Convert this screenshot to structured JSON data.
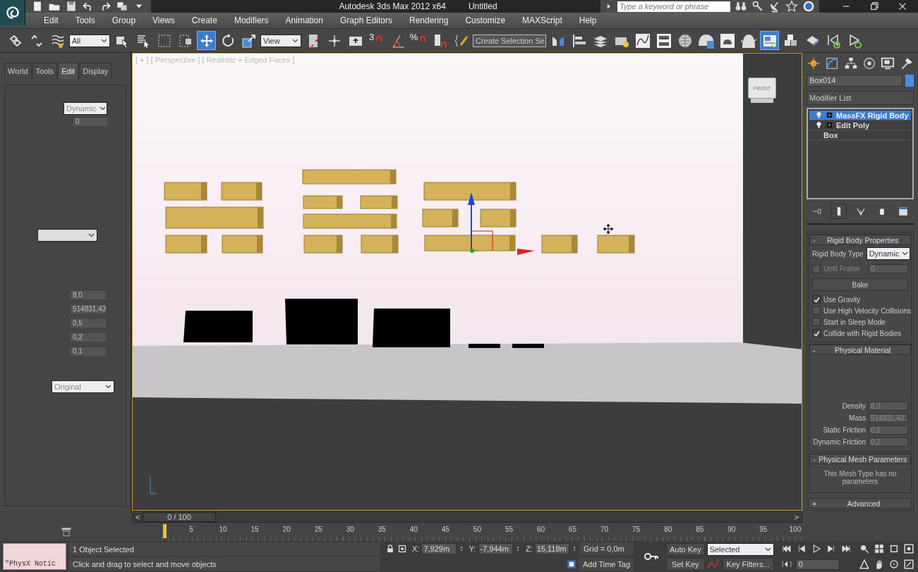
{
  "title_bar": {
    "app_title": "Autodesk 3ds Max  2012 x64",
    "document": "Untitled",
    "search": {
      "placeholder": "Type a keyword or phrase"
    }
  },
  "menu": [
    "Edit",
    "Tools",
    "Group",
    "Views",
    "Create",
    "Modifiers",
    "Animation",
    "Graph Editors",
    "Rendering",
    "Customize",
    "MAXScript",
    "Help"
  ],
  "toolbar": {
    "items": [
      {
        "kind": "icon",
        "selected": false
      },
      {
        "kind": "icon",
        "selected": false
      },
      {
        "kind": "icon",
        "selected": false
      },
      {
        "kind": "dropdown",
        "value": "All"
      },
      {
        "kind": "icon",
        "selected": false
      },
      {
        "kind": "icon",
        "selected": false
      },
      {
        "kind": "icon",
        "selected": false
      },
      {
        "kind": "icon",
        "selected": false
      },
      {
        "kind": "icon",
        "selected": true
      },
      {
        "kind": "icon",
        "selected": false
      },
      {
        "kind": "icon",
        "selected": false
      },
      {
        "kind": "dropdown",
        "value": "View"
      },
      {
        "kind": "icon",
        "selected": false
      },
      {
        "kind": "icon",
        "selected": false
      },
      {
        "kind": "icon",
        "selected": false
      },
      {
        "kind": "snap",
        "label": "3"
      },
      {
        "kind": "icon",
        "selected": false
      },
      {
        "kind": "snap",
        "label": "%"
      },
      {
        "kind": "icon",
        "selected": false
      },
      {
        "kind": "icon",
        "selected": false
      },
      {
        "kind": "dropdown",
        "value": "Create Selection Se"
      },
      {
        "kind": "icon",
        "selected": false
      },
      {
        "kind": "icon",
        "selected": false
      },
      {
        "kind": "icon",
        "selected": false
      },
      {
        "kind": "icon",
        "selected": false
      },
      {
        "kind": "icon",
        "selected": false
      },
      {
        "kind": "icon",
        "selected": false
      },
      {
        "kind": "icon",
        "selected": false
      },
      {
        "kind": "icon",
        "selected": false
      },
      {
        "kind": "icon",
        "selected": false
      },
      {
        "kind": "icon",
        "selected": false
      },
      {
        "kind": "icon",
        "selected": true
      },
      {
        "kind": "icon",
        "selected": false
      },
      {
        "kind": "icon",
        "selected": false
      },
      {
        "kind": "icon",
        "selected": false
      },
      {
        "kind": "icon",
        "selected": false
      }
    ]
  },
  "left_panel": {
    "tabs": [
      {
        "label": "World",
        "selected": false
      },
      {
        "label": "Tools",
        "selected": false
      },
      {
        "label": "Edit",
        "selected": true
      },
      {
        "label": "Display",
        "selected": false
      }
    ],
    "type_dropdown": "Dynamic",
    "frame_field": "0",
    "values": [
      "8,0",
      "514831,43",
      "0,5",
      "0,2",
      "0,1"
    ],
    "mesh_dropdown": "Original"
  },
  "viewport": {
    "label": "[ + ] [ Perspective ] [ Realistic + Edged Faces ]",
    "viewcube": "FRONT"
  },
  "command_panel": {
    "object_name": "Box014",
    "modifier_list": "Modifier List",
    "stack": [
      {
        "label": "MassFX Rigid Body",
        "selected": true,
        "kind": "modifier"
      },
      {
        "label": "Edit Poly",
        "selected": false,
        "kind": "modifier"
      },
      {
        "label": "Box",
        "selected": false,
        "kind": "base"
      }
    ],
    "rigid_body": {
      "sign": "-",
      "title": "Rigid Body Properties",
      "type_label": "Rigid Body Type",
      "type_value": "Dynamic",
      "until_frame": {
        "label": "Until Frame",
        "checked": false,
        "value": "0"
      },
      "bake": "Bake",
      "options": [
        {
          "label": "Use Gravity",
          "checked": true
        },
        {
          "label": "Use High Velocity Collisions",
          "checked": false
        },
        {
          "label": "Start in Sleep Mode",
          "checked": false
        },
        {
          "label": "Collide with Rigid Bodies",
          "checked": true
        }
      ]
    },
    "physical_material": {
      "sign": "-",
      "title": "Physical Material",
      "fields": [
        {
          "label": "Density",
          "value": "8,0"
        },
        {
          "label": "Mass",
          "value": "514831,43"
        },
        {
          "label": "Static Friction",
          "value": "0,5"
        },
        {
          "label": "Dynamic Friction",
          "value": "0,2"
        }
      ]
    },
    "mesh_params": {
      "sign": "-",
      "title": "Physical Mesh Parameters",
      "note": "This Mesh Type has no parameters"
    },
    "advanced": {
      "sign": "+",
      "title": "Advanced"
    }
  },
  "timeline": {
    "prev": "<",
    "position": "0 / 100",
    "next": ">",
    "level": 0,
    "ticks": [
      "5",
      "10",
      "15",
      "20",
      "25",
      "30",
      "35",
      "40",
      "45",
      "50",
      "55",
      "60",
      "65",
      "70",
      "75",
      "80",
      "85",
      "90",
      "95",
      "100"
    ]
  },
  "status_bar": {
    "notice": "\"PhysX Notic",
    "selection": "1 Object Selected",
    "prompt": "Click and drag to select and move objects",
    "coords": [
      {
        "axis": "X:",
        "value": "7,929m"
      },
      {
        "axis": "Y:",
        "value": "-7,944m"
      },
      {
        "axis": "Z:",
        "value": "15,118m"
      }
    ],
    "grid": "Grid = 0,0m",
    "time_tag": "Add Time Tag",
    "auto_key": "Auto Key",
    "key_mode": "Selected",
    "set_key": "Set Key",
    "key_filters": "Key Filters...",
    "frame": "0"
  }
}
